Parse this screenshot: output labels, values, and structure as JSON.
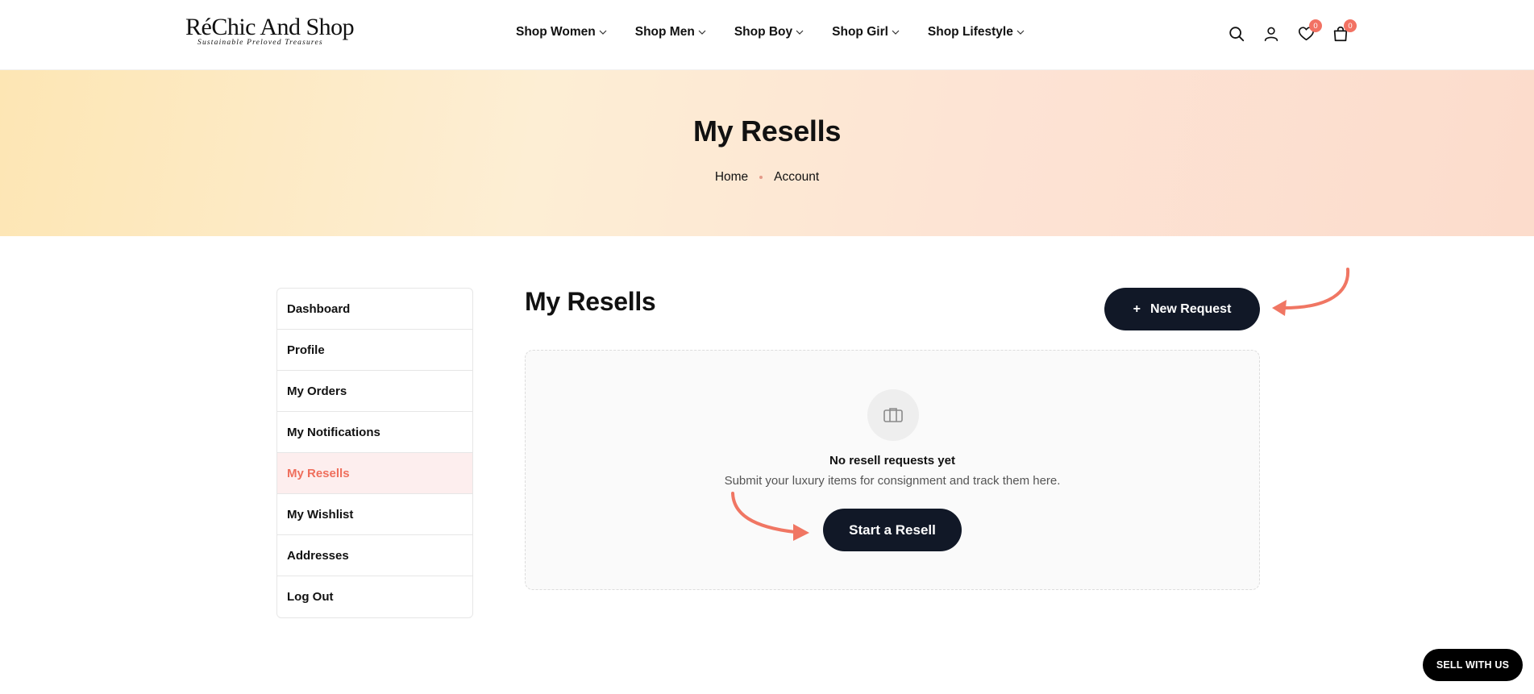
{
  "header": {
    "logo_main": "RéChic And Shop",
    "logo_tagline": "Sustainable Preloved Treasures",
    "nav": [
      {
        "label": "Shop Women"
      },
      {
        "label": "Shop Men"
      },
      {
        "label": "Shop Boy"
      },
      {
        "label": "Shop Girl"
      },
      {
        "label": "Shop Lifestyle"
      }
    ],
    "icons": {
      "search": "search-icon",
      "account": "user-icon",
      "wishlist": "heart-icon",
      "cart": "bag-icon"
    },
    "wishlist_count": "0",
    "cart_count": "0"
  },
  "banner": {
    "title": "My Resells",
    "breadcrumb": [
      "Home",
      "Account"
    ]
  },
  "sidebar": {
    "items": [
      {
        "label": "Dashboard"
      },
      {
        "label": "Profile"
      },
      {
        "label": "My Orders"
      },
      {
        "label": "My Notifications"
      },
      {
        "label": "My Resells",
        "active": true
      },
      {
        "label": "My Wishlist"
      },
      {
        "label": "Addresses"
      },
      {
        "label": "Log Out"
      }
    ]
  },
  "main": {
    "title": "My Resells",
    "new_request_label": "New Request",
    "new_request_icon": "+",
    "empty": {
      "icon": "briefcase-icon",
      "title": "No resell requests yet",
      "subtitle": "Submit your luxury items for consignment and track them here.",
      "cta_label": "Start a Resell"
    }
  },
  "floating": {
    "sell_with_us_label": "SELL WITH US"
  },
  "colors": {
    "accent": "#ef6e5c",
    "dark_button": "#111827",
    "active_bg": "#fdeeee"
  }
}
